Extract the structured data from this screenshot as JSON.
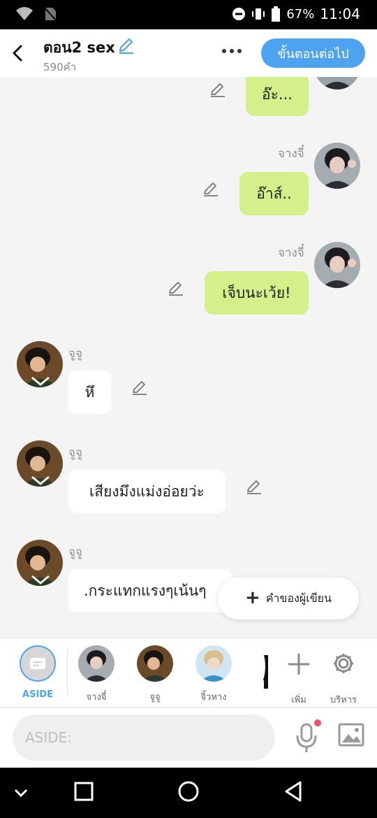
{
  "status": {
    "battery": "67%",
    "time": "11:04"
  },
  "header": {
    "title": "ตอน2 sex",
    "word_count": "590คำ",
    "next_label": "ขั้นตอนต่อไป"
  },
  "messages": [
    {
      "side": "right",
      "name": "",
      "text": "อ๊ะ..."
    },
    {
      "side": "right",
      "name": "จางจี๋",
      "text": "อ๊าส์.."
    },
    {
      "side": "right",
      "name": "จางจี๋",
      "text": "เจ็บนะเว้ย!"
    },
    {
      "side": "left",
      "name": "จูจู",
      "text": "หึ"
    },
    {
      "side": "left",
      "name": "จูจู",
      "text": "เสียงมึงแม่งอ่อยว่ะ"
    },
    {
      "side": "left",
      "name": "จูจู",
      "text": ".กระแทกแรงๆเน้นๆ"
    }
  ],
  "author_note_label": "คำของผู้เขียน",
  "characters": [
    {
      "label": "ASIDE"
    },
    {
      "label": "จางจี๋"
    },
    {
      "label": "จูจู"
    },
    {
      "label": "จิ้วหาง"
    }
  ],
  "actions": {
    "add_label": "เพิ่ม",
    "manage_label": "บริหาร"
  },
  "input": {
    "placeholder": "ASIDE:"
  },
  "colors": {
    "accent": "#4da3ef",
    "green_bubble": "#d4f08a",
    "white_bubble": "#ffffff",
    "background": "#f4f4f4"
  }
}
